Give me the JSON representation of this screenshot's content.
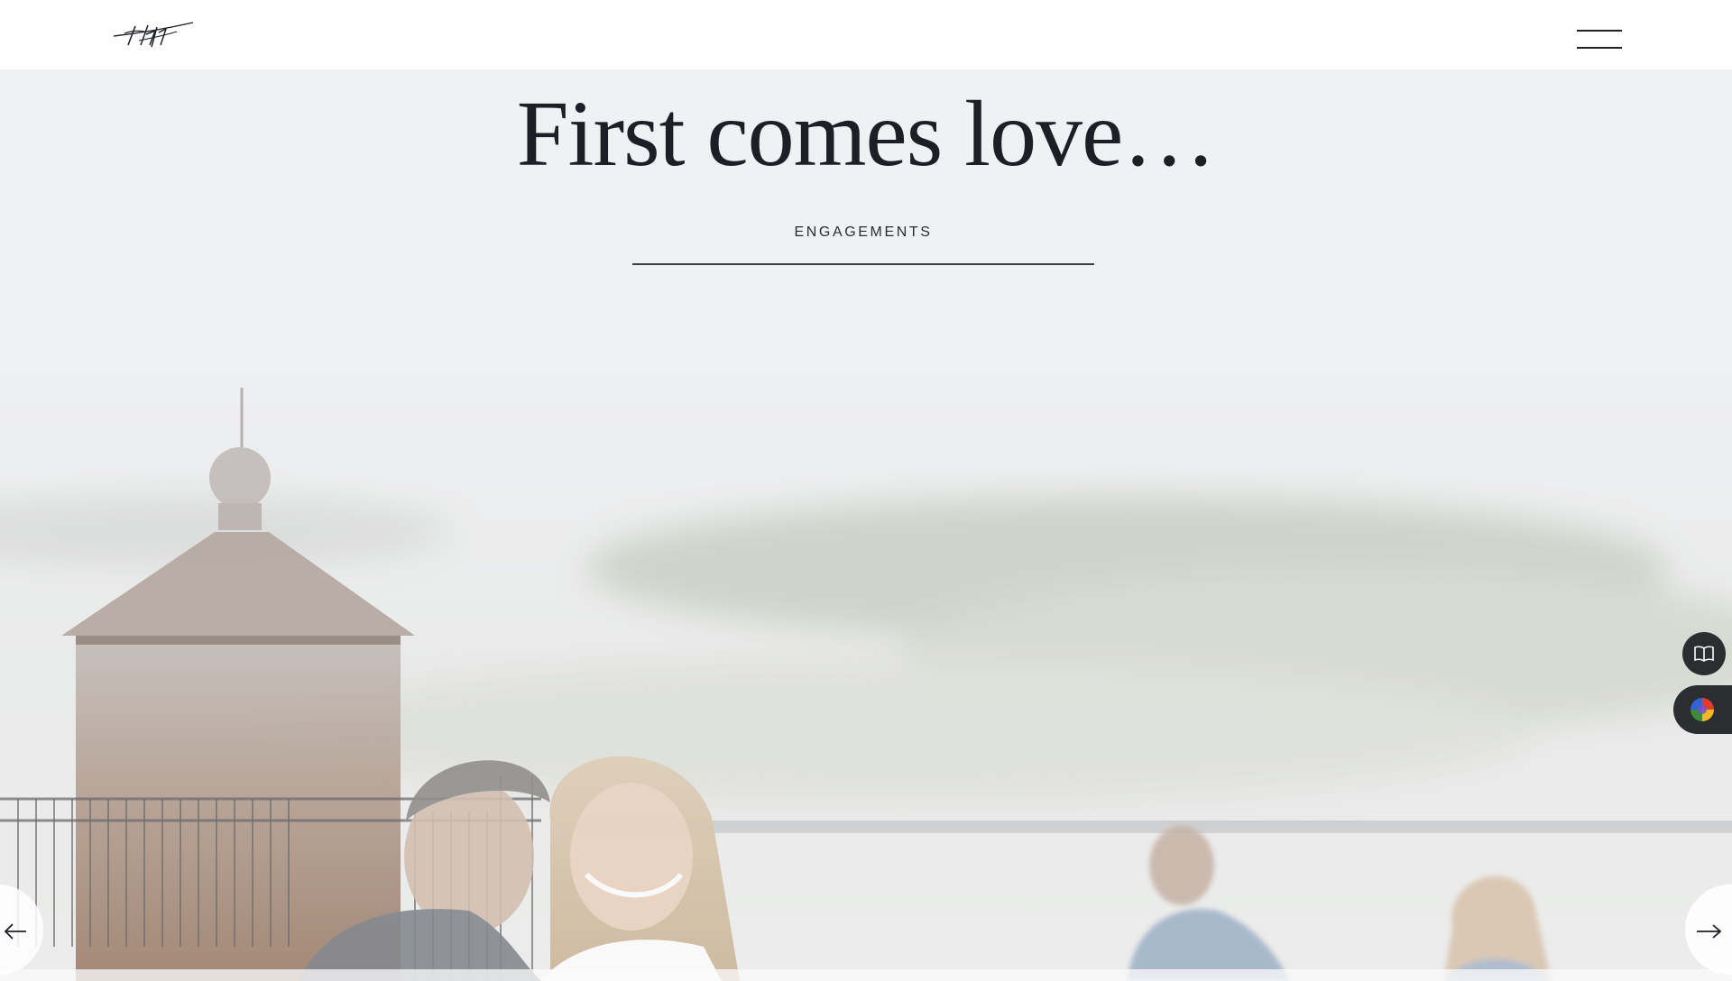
{
  "header": {
    "logo_alt": "signature logo",
    "menu_icon": "hamburger-menu-icon"
  },
  "hero": {
    "title": "First comes love…",
    "subtitle": "ENGAGEMENTS"
  },
  "slider": {
    "image_alt": "Engaged couple smiling beside a lighthouse railing",
    "prev_icon": "arrow-left-icon",
    "next_icon": "arrow-right-icon"
  },
  "widgets": {
    "book_icon": "open-book-icon",
    "color_icon": "color-wheel-icon"
  },
  "colors": {
    "text": "#1e2128",
    "background": "#f0f1f3",
    "widget": "#2b2d31"
  }
}
